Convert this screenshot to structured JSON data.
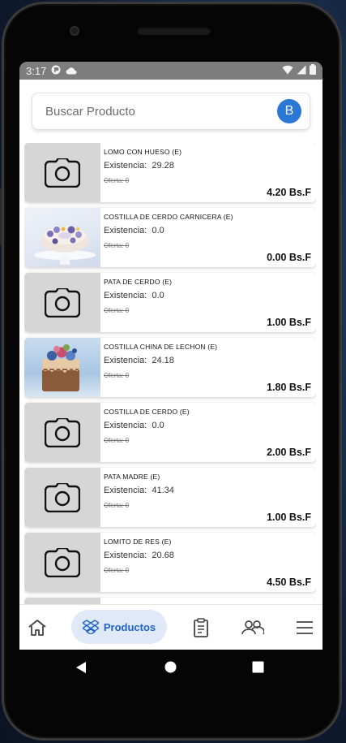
{
  "status": {
    "time": "3:17"
  },
  "search": {
    "placeholder": "Buscar Producto",
    "avatar_letter": "B"
  },
  "products": [
    {
      "name": "LOMO CON HUESO (E)",
      "stock_label": "Existencia:",
      "stock": "29.28",
      "offer": "Oferta: 0",
      "price": "4.20 Bs.F",
      "image": "camera-placeholder"
    },
    {
      "name": "COSTILLA DE CERDO CARNICERA (E)",
      "stock_label": "Existencia:",
      "stock": "0.0",
      "offer": "Oferta: 0",
      "price": "0.00 Bs.F",
      "image": "cake-photo"
    },
    {
      "name": "PATA DE CERDO (E)",
      "stock_label": "Existencia:",
      "stock": "0.0",
      "offer": "Oferta: 0",
      "price": "1.00 Bs.F",
      "image": "camera-placeholder"
    },
    {
      "name": "COSTILLA CHINA DE LECHON (E)",
      "stock_label": "Existencia:",
      "stock": "24.18",
      "offer": "Oferta: 0",
      "price": "1.80 Bs.F",
      "image": "cake-photo"
    },
    {
      "name": "COSTILLA DE CERDO (E)",
      "stock_label": "Existencia:",
      "stock": "0.0",
      "offer": "Oferta: 0",
      "price": "2.00 Bs.F",
      "image": "camera-placeholder"
    },
    {
      "name": "PATA MADRE (E)",
      "stock_label": "Existencia:",
      "stock": "41.34",
      "offer": "Oferta: 0",
      "price": "1.00 Bs.F",
      "image": "camera-placeholder"
    },
    {
      "name": "LOMITO DE RES (E)",
      "stock_label": "Existencia:",
      "stock": "20.68",
      "offer": "Oferta: 0",
      "price": "4.50 Bs.F",
      "image": "camera-placeholder"
    }
  ],
  "nav": {
    "active_label": "Productos"
  },
  "colors": {
    "accent": "#1f63c9",
    "avatar": "#2a77d6",
    "status_bar": "#7d7d7d",
    "active_pill": "#dfe9f7"
  }
}
